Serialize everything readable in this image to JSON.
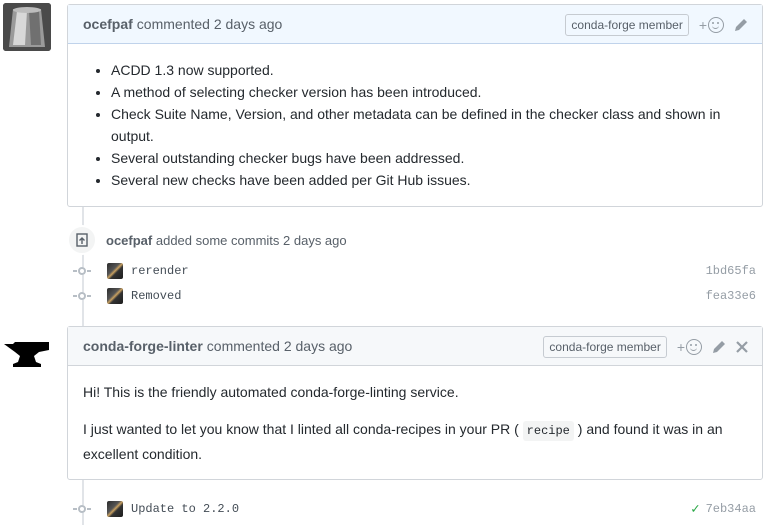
{
  "comment1": {
    "author": "ocefpaf",
    "meta": "commented 2 days ago",
    "badge": "conda-forge member",
    "reaction_plus": "+",
    "items": [
      "ACDD 1.3 now supported.",
      "A method of selecting checker version has been introduced.",
      "Check Suite Name, Version, and other metadata can be defined in the checker class and shown in output.",
      "Several outstanding checker bugs have been addressed.",
      "Several new checks have been added per Git Hub issues."
    ]
  },
  "event": {
    "author": "ocefpaf",
    "text": "added some commits 2 days ago"
  },
  "commits": [
    {
      "message": "rerender",
      "sha": "1bd65fa"
    },
    {
      "message": "Removed",
      "sha": "fea33e6"
    }
  ],
  "comment2": {
    "author": "conda-forge-linter",
    "meta": "commented 2 days ago",
    "badge": "conda-forge member",
    "reaction_plus": "+",
    "paragraph1": "Hi! This is the friendly automated conda-forge-linting service.",
    "paragraph2_before": "I just wanted to let you know that I linted all conda-recipes in your PR (",
    "paragraph2_code": "recipe",
    "paragraph2_after": ") and found it was in an excellent condition."
  },
  "commit3": {
    "message": "Update to 2.2.0",
    "sha": "7eb34aa",
    "status": "success"
  }
}
